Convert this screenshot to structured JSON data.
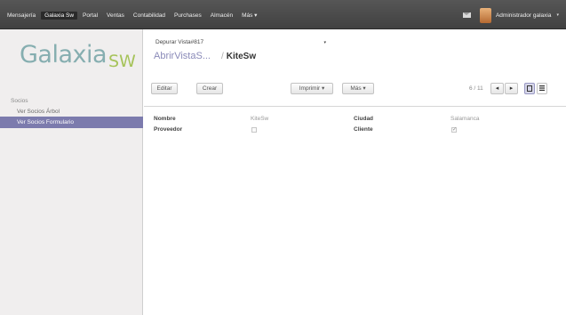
{
  "topbar": {
    "menu": [
      {
        "label": "Mensajería",
        "active": false
      },
      {
        "label": "Galaxia Sw",
        "active": true
      },
      {
        "label": "Portal",
        "active": false
      },
      {
        "label": "Ventas",
        "active": false
      },
      {
        "label": "Contabilidad",
        "active": false
      },
      {
        "label": "Purchases",
        "active": false
      },
      {
        "label": "Almacén",
        "active": false
      },
      {
        "label": "Más ▾",
        "active": false
      }
    ],
    "user_name": "Administrador galaxia",
    "user_caret": "▾"
  },
  "sidebar": {
    "logo_main": "Galaxia",
    "logo_sw": "SW",
    "section_title": "Socios",
    "items": [
      {
        "label": "Ver Socios Árbol",
        "selected": false
      },
      {
        "label": "Ver Socios Formulario",
        "selected": true
      }
    ]
  },
  "header": {
    "debug_select": "Depurar Vista#817",
    "debug_caret": "▾",
    "breadcrumb_parent": "AbrirVistaS...",
    "breadcrumb_sep": "/",
    "breadcrumb_current": "KiteSw",
    "edit_label": "Editar",
    "create_label": "Crear",
    "print_label": "Imprimir ▾",
    "more_label": "Más ▾",
    "pager": "6 / 11",
    "prev_icon": "◂",
    "next_icon": "▸"
  },
  "form": {
    "name_label": "Nombre",
    "name_value": "KiteSw",
    "city_label": "Ciudad",
    "city_value": "Salamanca",
    "supplier_label": "Proveedor",
    "supplier_checked": false,
    "customer_label": "Cliente",
    "customer_checked": true,
    "check_mark": "✓"
  },
  "colors": {
    "topbar": "#4a4a4a",
    "sidebar_selected": "#7c7bad",
    "breadcrumb_link": "#8a8ab8",
    "logo_main": "#86aeb0",
    "logo_sw": "#a6c35a"
  }
}
